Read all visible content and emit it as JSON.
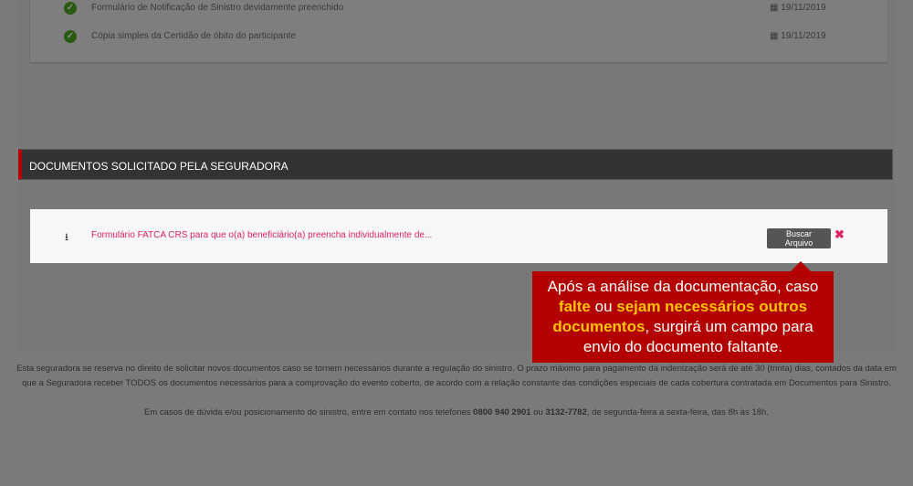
{
  "received_docs": [
    {
      "label": "Formulário de Notificação de Sinistro devidamente preenchido",
      "date": "19/11/2019"
    },
    {
      "label": "Cópia simples da Certidão de óbito do participante",
      "date": "19/11/2019"
    }
  ],
  "section_title": "DOCUMENTOS SOLICITADO PELA SEGURADORA",
  "requested_doc": {
    "label": "Formulário FATCA CRS para que o(a) beneficiário(a) preencha individualmente de...",
    "button": "Buscar Arquivo"
  },
  "tooltip": {
    "t1": "Após a análise da documentação, caso ",
    "t2": "falte",
    "t3": " ou ",
    "t4": "sejam necessários outros documentos",
    "t5": ", surgirá um campo para envio do documento faltante."
  },
  "footer": {
    "p1": "Esta seguradora se reserva no direito de solicitar novos documentos caso se tornem necessários durante a regulação do sinistro. O prazo máximo para pagamento da indenização será de até 30 (trinta) dias, contados da data em que a Seguradora receber TODOS os documentos necessários para a comprovação do evento coberto, de acordo com a relação constante das condições especiais de cada cobertura contratada em Documentos para Sinistro.",
    "p2a": "Em casos de dúvida e/ou posicionamento do sinistro, entre em contato nos telefones ",
    "phone1": "0800 940 2901",
    "p2b": " ou ",
    "phone2": "3132-7782",
    "p2c": ", de segunda-feira a sexta-feira, das 8h às 18h."
  }
}
